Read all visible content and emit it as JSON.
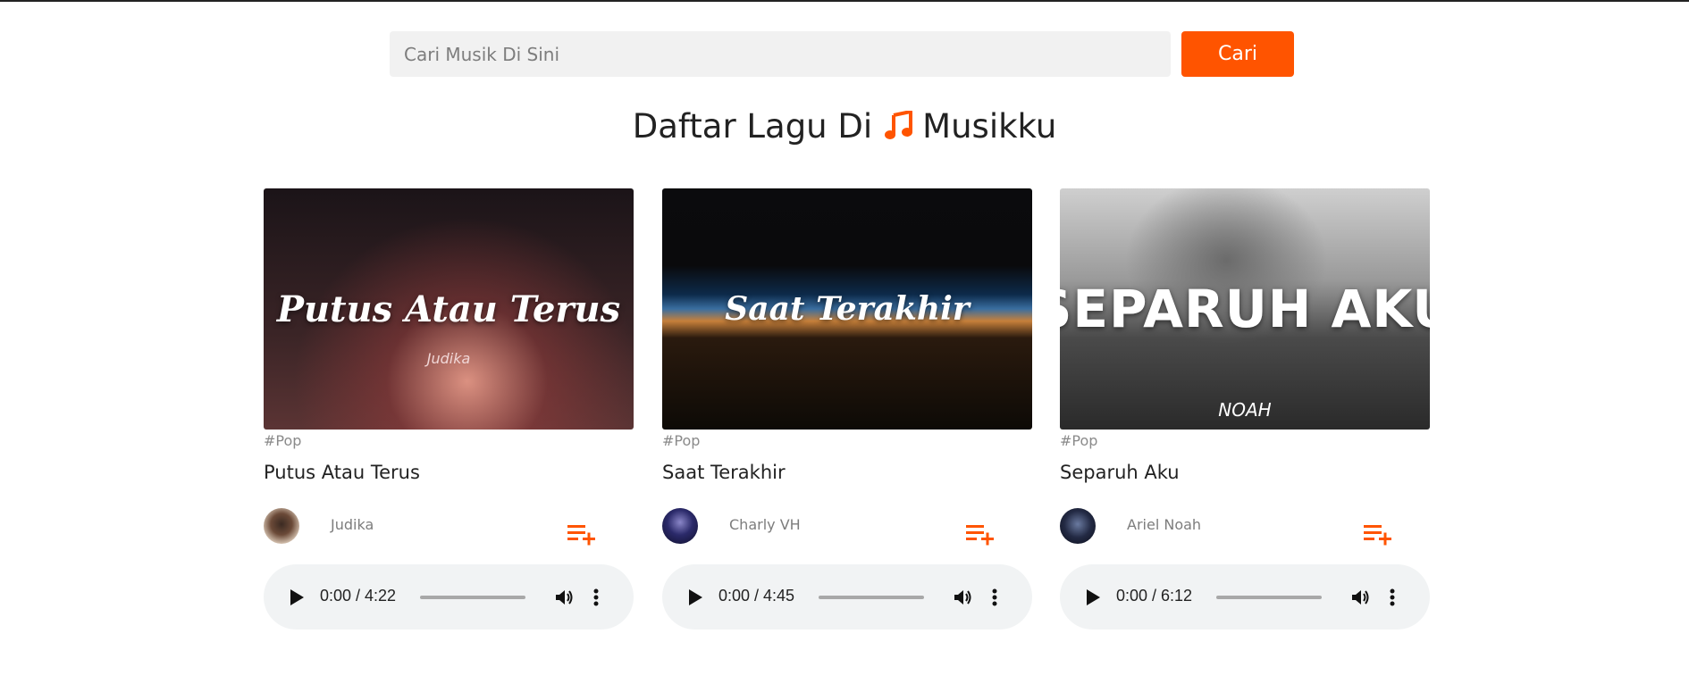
{
  "search": {
    "placeholder": "Cari Musik Di Sini",
    "button_label": "Cari"
  },
  "header": {
    "title_before": "Daftar Lagu Di",
    "title_after": "Musikku"
  },
  "colors": {
    "accent": "#ff5400",
    "player_bg": "#f1f3f4",
    "input_bg": "#f1f1f1"
  },
  "songs": [
    {
      "cover_title": "Putus Atau Terus",
      "cover_subtitle": "Judika",
      "genre": "#Pop",
      "title": "Putus Atau Terus",
      "artist": "Judika",
      "time": "0:00 / 4:22"
    },
    {
      "cover_title": "Saat Terakhir",
      "genre": "#Pop",
      "title": "Saat Terakhir",
      "artist": "Charly VH",
      "time": "0:00 / 4:45"
    },
    {
      "cover_title": "SEPARUH AKU",
      "cover_subtitle": "NOAH",
      "genre": "#Pop",
      "title": "Separuh Aku",
      "artist": "Ariel Noah",
      "time": "0:00 / 6:12"
    }
  ],
  "icons": {
    "title": "music-note-icon",
    "add_to_playlist": "playlist-add-icon",
    "player": [
      "play-icon",
      "volume-icon",
      "more-vertical-icon"
    ]
  }
}
